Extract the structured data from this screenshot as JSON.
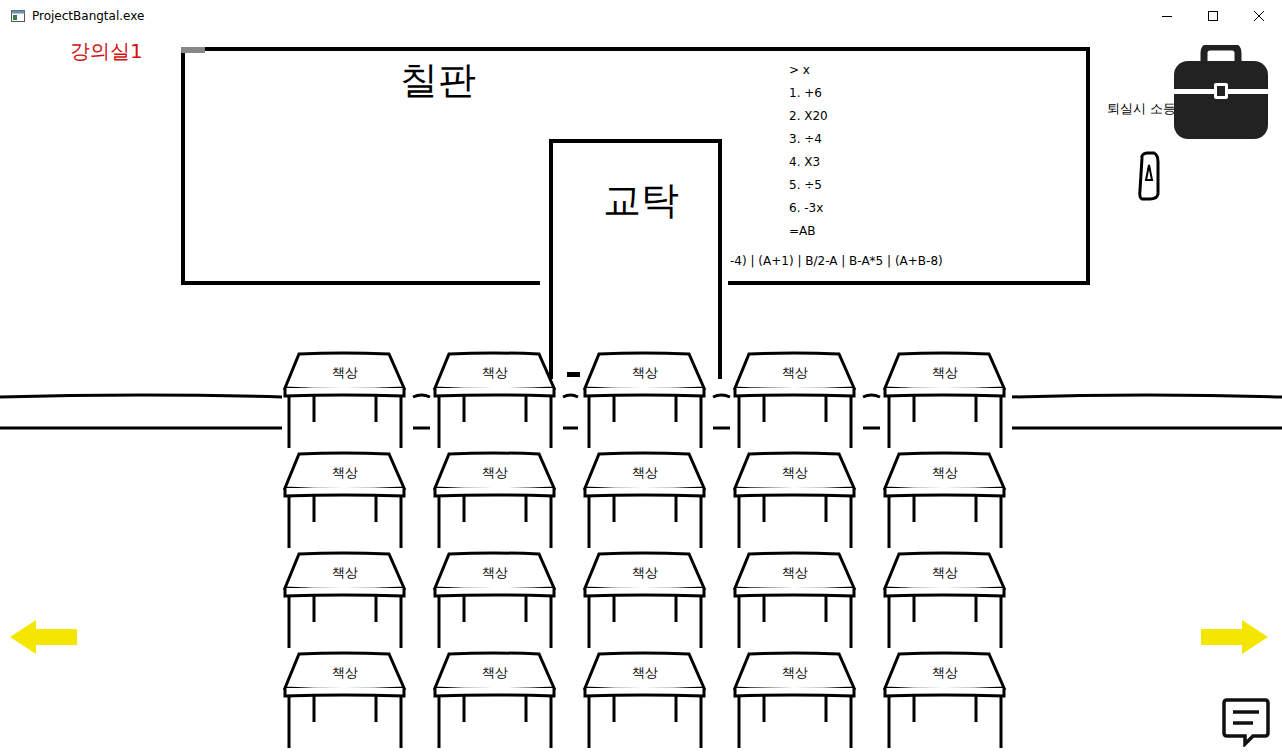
{
  "window": {
    "title": "ProjectBangtal.exe"
  },
  "scene": {
    "room_label": "강의실1",
    "blackboard_label": "칠판",
    "podium_label": "교탁",
    "board_lines": [
      "> x",
      "1. +6",
      "2. X20",
      "3. ÷4",
      "4. X3",
      "5. ÷5",
      "6. -3x",
      "=AB"
    ],
    "board_equation": "-4) | (A+1) | B/2-A | B-A*5 | (A+B-8)",
    "notice": "퇴실시 소등할 것",
    "desks": [
      "책상",
      "책상",
      "책상",
      "책상",
      "책상",
      "책상",
      "책상",
      "책상",
      "책상",
      "책상",
      "책상",
      "책상",
      "책상",
      "책상",
      "책상",
      "책상",
      "책상",
      "책상",
      "책상",
      "책상"
    ]
  }
}
